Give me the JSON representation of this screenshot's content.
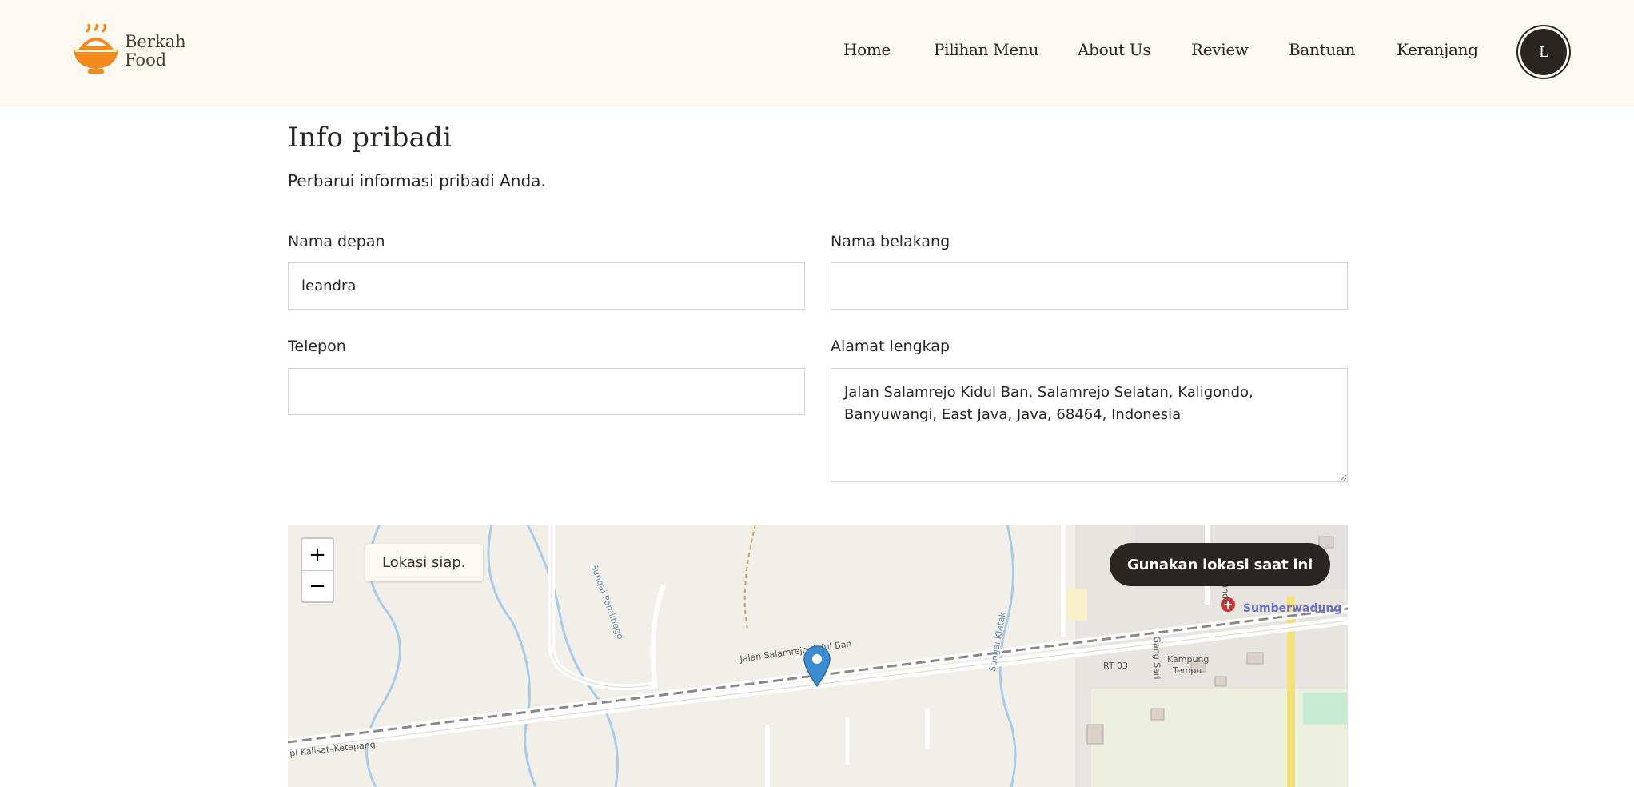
{
  "brand": {
    "name": "Berkah\nFood",
    "logo_icon": "food-bowl-icon",
    "accent": "#f28a1e"
  },
  "nav": {
    "items": [
      "Home",
      "Pilihan Menu",
      "About Us",
      "Review",
      "Bantuan",
      "Keranjang"
    ],
    "avatar_initial": "L"
  },
  "form": {
    "title": "Info pribadi",
    "subtitle": "Perbarui informasi pribadi Anda.",
    "first_name": {
      "label": "Nama depan",
      "value": "leandra"
    },
    "last_name": {
      "label": "Nama belakang",
      "value": ""
    },
    "phone": {
      "label": "Telepon",
      "value": ""
    },
    "address": {
      "label": "Alamat lengkap",
      "value": "Jalan Salamrejo Kidul Ban, Salamrejo Selatan, Kaligondo,\nBanyuwangi, East Java, Java, 68464, Indonesia"
    }
  },
  "map": {
    "zoom_in": "+",
    "zoom_out": "−",
    "status": "Lokasi siap.",
    "use_location_label": "Gunakan lokasi saat ini",
    "marker_color": "#3d8bd0",
    "labels": {
      "road": "Jalan Salamrejo Kidul Ban",
      "river1": "Sungai Porolinggo",
      "river2": "Sungai Klatak",
      "village": "Sumberwadung",
      "rail": "pi Kalisat–Ketapang",
      "rt": "RT 03",
      "gang": "Gang Sari",
      "kampung": "Kampung",
      "temple": "Tempu",
      "road2": "Sebergundo"
    }
  }
}
